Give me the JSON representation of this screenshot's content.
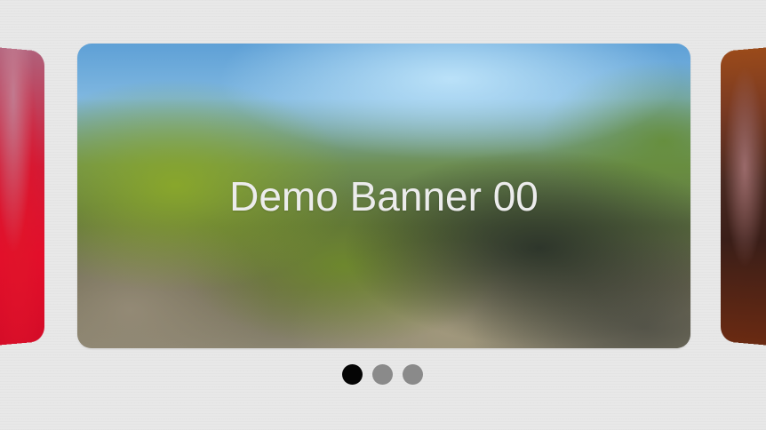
{
  "carousel": {
    "slides": [
      {
        "title": "Demo Banner 00"
      }
    ],
    "active_index": 0,
    "pagination": {
      "count": 3,
      "active": 0,
      "active_color": "#050505",
      "inactive_color": "#8a8a8a"
    }
  }
}
